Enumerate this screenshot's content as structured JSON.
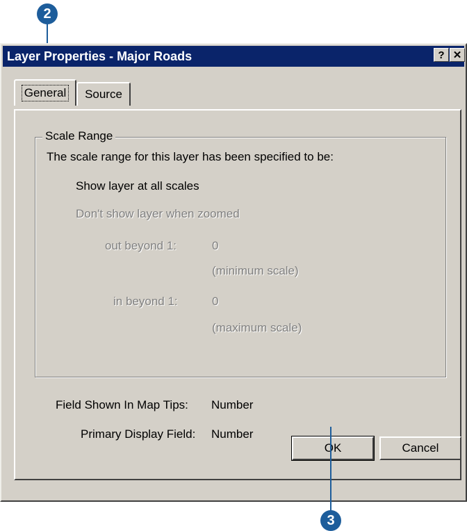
{
  "callouts": {
    "top": "2",
    "bottom": "3"
  },
  "window": {
    "title": "Layer Properties - Major Roads",
    "help_label": "?",
    "close_label": "✕"
  },
  "tabs": [
    {
      "label": "General",
      "selected": true
    },
    {
      "label": "Source",
      "selected": false
    }
  ],
  "scale_range": {
    "group_title": "Scale Range",
    "description": "The scale range for this layer has been specified to be:",
    "option_all": "Show layer at all scales",
    "option_zoomed": "Don't show layer when zoomed",
    "out_label": "out beyond 1:",
    "out_value": "0",
    "out_note": "(minimum scale)",
    "in_label": "in beyond 1:",
    "in_value": "0",
    "in_note": "(maximum scale)"
  },
  "fields": {
    "map_tips_label": "Field Shown In Map Tips:",
    "map_tips_value": "Number",
    "display_label": "Primary Display Field:",
    "display_value": "Number"
  },
  "buttons": {
    "ok": "OK",
    "cancel": "Cancel"
  },
  "colors": {
    "callout": "#1d5d9b",
    "titlebar": "#0a246a",
    "face": "#d4d0c8"
  }
}
